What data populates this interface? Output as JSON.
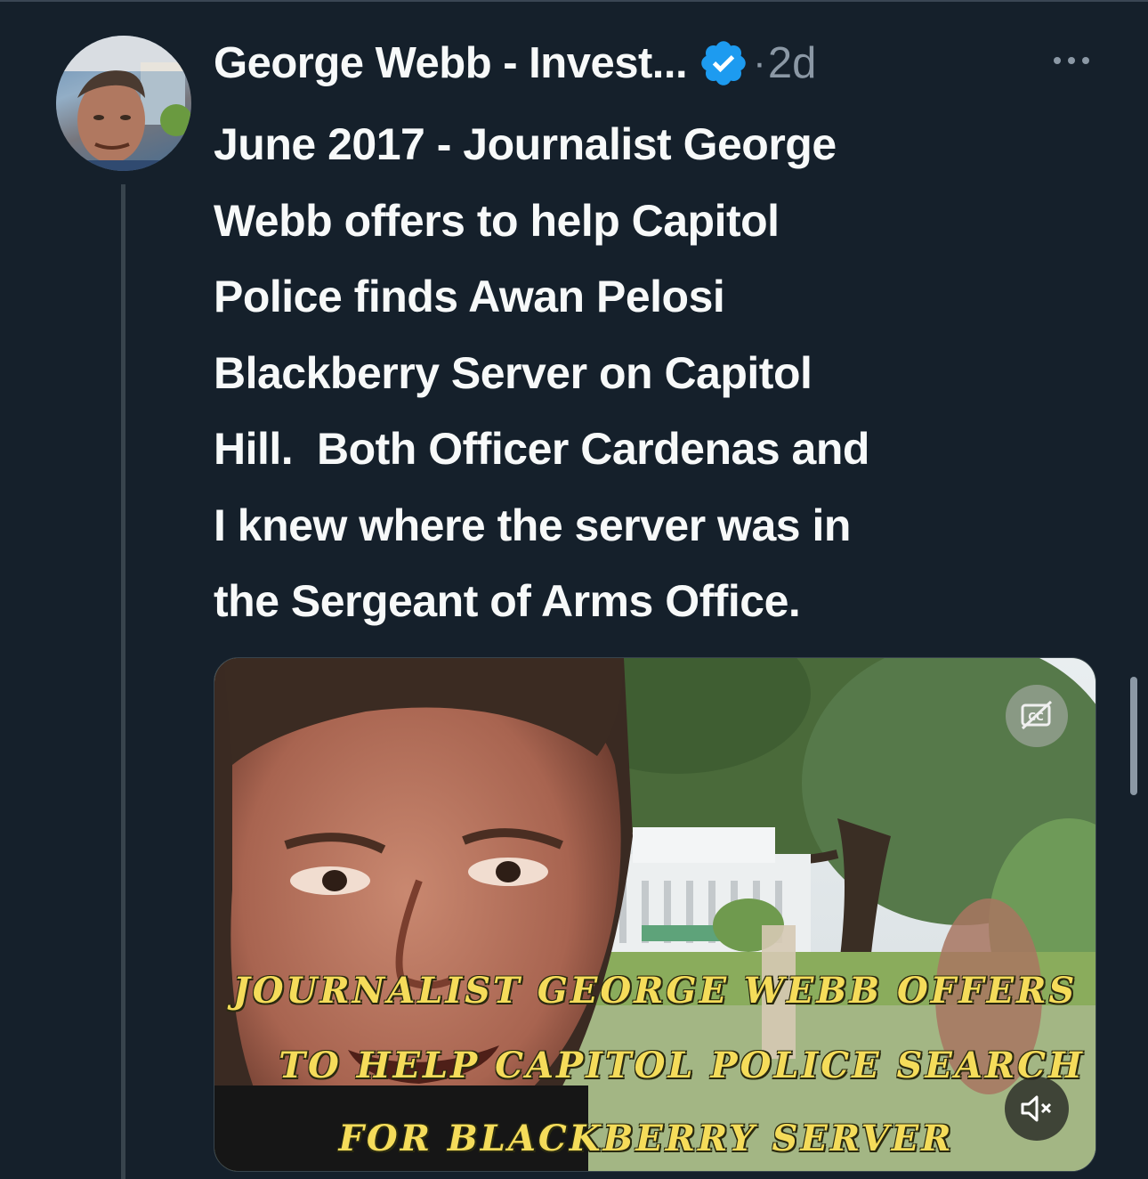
{
  "tweet": {
    "display_name": "George Webb - Invest...",
    "verified": true,
    "separator": "·",
    "time": "2d",
    "more_icon": "more-horizontal-icon",
    "text": "June 2017 - Journalist George\nWebb offers to help Capitol\nPolice finds Awan Pelosi\nBlackberry Server on Capitol\nHill.  Both Officer Cardenas and\nI knew where the server was in\nthe Sergeant of Arms Office."
  },
  "media": {
    "caption_lines": [
      "JOURNALIST GEORGE WEBB OFFERS",
      "TO HELP CAPITOL POLICE SEARCH",
      "FOR BLACKBERRY SERVER"
    ],
    "cc_icon": "closed-captions-off-icon",
    "mute_icon": "muted-speaker-icon"
  },
  "colors": {
    "background": "#15202b",
    "text": "#f7f9f9",
    "secondary_text": "#8b98a5",
    "verified_badge": "#1d9bf0",
    "caption": "#f5dc5a"
  }
}
